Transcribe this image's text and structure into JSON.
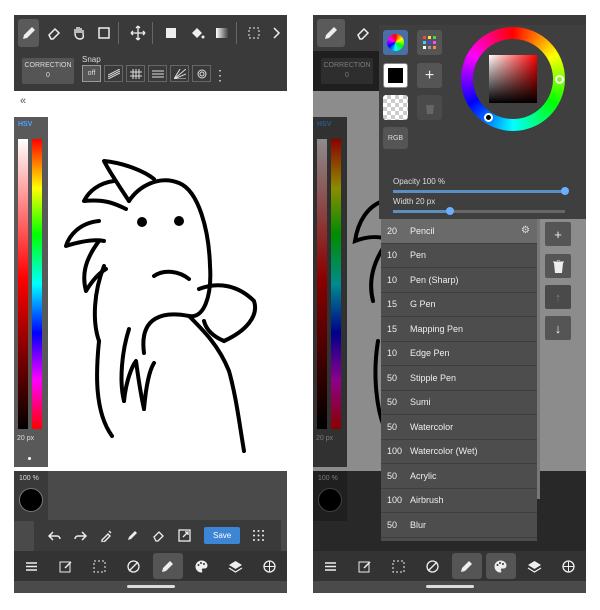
{
  "left": {
    "correction": {
      "label": "CORRECTION",
      "value": "0"
    },
    "snap_label": "Snap",
    "snap_off": "off",
    "hsv": "HSV",
    "brush_size": "20 px",
    "opacity": "100 %",
    "save_label": "Save"
  },
  "right": {
    "correction": {
      "label": "CORRECTION",
      "value": "0"
    },
    "hsv": "HSV",
    "brush_size": "20 px",
    "opacity": "100 %",
    "rgb_label": "RGB",
    "opacity_label": "Opacity 100 %",
    "opacity_value": 1.0,
    "width_label": "Width 20 px",
    "width_value": 0.33,
    "brushes": [
      {
        "size": "20",
        "name": "Pencil"
      },
      {
        "size": "10",
        "name": "Pen"
      },
      {
        "size": "10",
        "name": "Pen (Sharp)"
      },
      {
        "size": "15",
        "name": "G Pen"
      },
      {
        "size": "15",
        "name": "Mapping Pen"
      },
      {
        "size": "10",
        "name": "Edge Pen"
      },
      {
        "size": "50",
        "name": "Stipple Pen"
      },
      {
        "size": "50",
        "name": "Sumi"
      },
      {
        "size": "50",
        "name": "Watercolor"
      },
      {
        "size": "100",
        "name": "Watercolor (Wet)"
      },
      {
        "size": "50",
        "name": "Acrylic"
      },
      {
        "size": "100",
        "name": "Airbrush"
      },
      {
        "size": "50",
        "name": "Blur"
      }
    ]
  },
  "colors": {
    "accent": "#3d86d6",
    "toolbar": "#3a3a3a",
    "panel": "#4d4d4d"
  }
}
